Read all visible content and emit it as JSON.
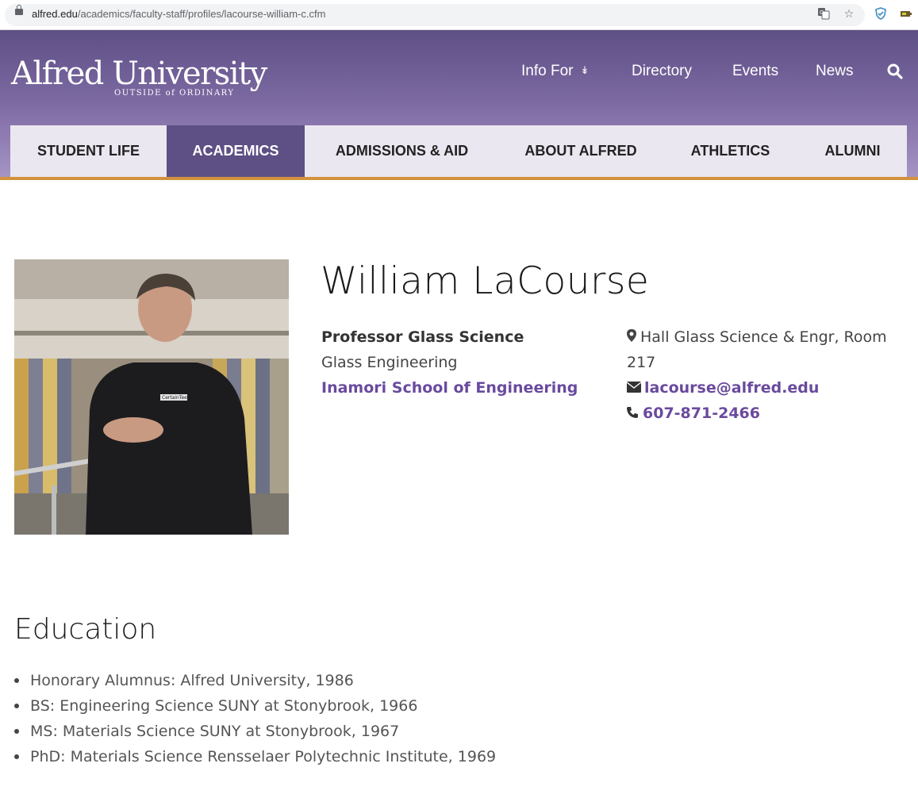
{
  "browser": {
    "url_domain": "alfred.edu",
    "url_path": "/academics/faculty-staff/profiles/lacourse-william-c.cfm"
  },
  "header": {
    "logo_name": "Alfred University",
    "logo_tagline": "OUTSIDE of ORDINARY",
    "top_links": [
      "Info For",
      "Directory",
      "Events",
      "News"
    ]
  },
  "main_nav": {
    "tabs": [
      "STUDENT LIFE",
      "ACADEMICS",
      "ADMISSIONS & AID",
      "ABOUT ALFRED",
      "ATHLETICS",
      "ALUMNI"
    ],
    "active": "ACADEMICS"
  },
  "profile": {
    "name": "William LaCourse",
    "title": "Professor Glass Science",
    "department": "Glass Engineering",
    "school": "Inamori School of Engineering",
    "location": "Hall Glass Science & Engr, Room 217",
    "email": "lacourse@alfred.edu",
    "phone": "607-871-2466",
    "photo_shirt_text": "CertainTeed"
  },
  "education": {
    "heading": "Education",
    "items": [
      "Honorary Alumnus: Alfred University, 1986",
      "BS: Engineering Science SUNY at Stonybrook, 1966",
      "MS: Materials Science SUNY at Stonybrook, 1967",
      "PhD: Materials Science Rensselaer Polytechnic Institute, 1969"
    ]
  },
  "colors": {
    "header_purple": "#5e4f85",
    "nav_accent_gold": "#d4913d",
    "link_purple": "#6a4a9e"
  }
}
